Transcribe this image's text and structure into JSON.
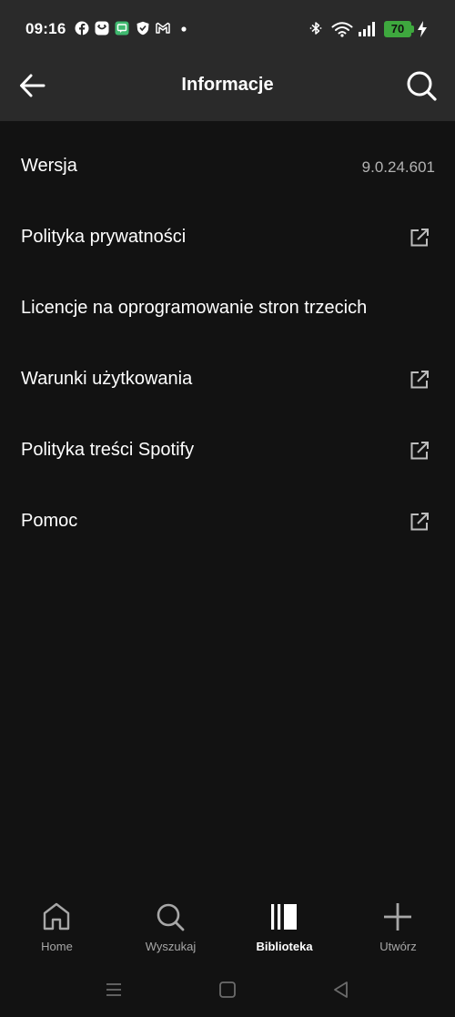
{
  "status_bar": {
    "time": "09:16",
    "battery": "70",
    "notification_icons": [
      "facebook-icon",
      "messenger-icon",
      "chat-icon",
      "shield-icon",
      "gmail-icon",
      "dot-icon"
    ],
    "system_icons": [
      "bluetooth-icon",
      "wifi-icon",
      "signal-icon",
      "battery-icon",
      "charging-icon"
    ]
  },
  "header": {
    "title": "Informacje"
  },
  "info_list": {
    "items": [
      {
        "label": "Wersja",
        "value": "9.0.24.601",
        "external": false
      },
      {
        "label": "Polityka prywatności",
        "external": true
      },
      {
        "label": "Licencje na oprogramowanie stron trzecich",
        "external": false
      },
      {
        "label": "Warunki użytkowania",
        "external": true
      },
      {
        "label": "Polityka treści Spotify",
        "external": true
      },
      {
        "label": "Pomoc",
        "external": true
      }
    ]
  },
  "bottom_nav": {
    "items": [
      {
        "label": "Home",
        "icon": "home-icon",
        "active": false
      },
      {
        "label": "Wyszukaj",
        "icon": "search-icon",
        "active": false
      },
      {
        "label": "Biblioteka",
        "icon": "library-icon",
        "active": true
      },
      {
        "label": "Utwórz",
        "icon": "plus-icon",
        "active": false
      }
    ]
  },
  "colors": {
    "background": "#121212",
    "header_background": "#2a2a2a",
    "text_primary": "#ffffff",
    "text_secondary": "#b3b3b3",
    "battery": "#3ea83e"
  }
}
